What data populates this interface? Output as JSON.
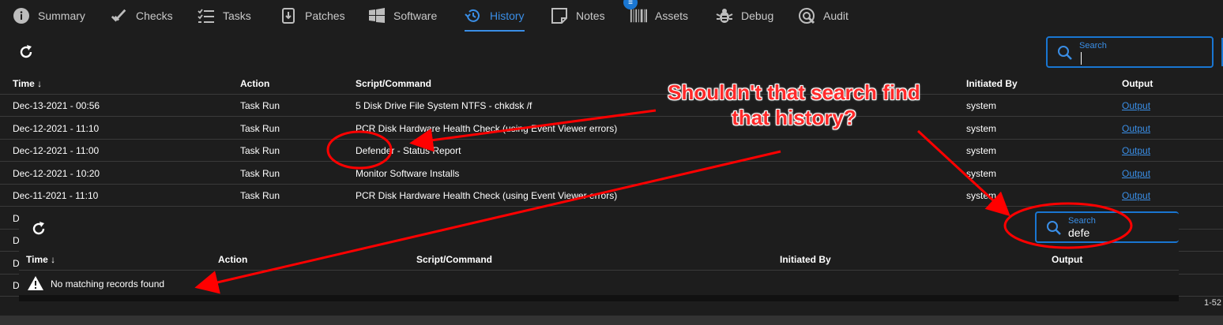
{
  "tabs": [
    {
      "label": "Summary",
      "icon": "info-icon"
    },
    {
      "label": "Checks",
      "icon": "double-check-icon"
    },
    {
      "label": "Tasks",
      "icon": "checklist-icon"
    },
    {
      "label": "Patches",
      "icon": "download-box-icon"
    },
    {
      "label": "Software",
      "icon": "windows-icon"
    },
    {
      "label": "History",
      "icon": "history-icon",
      "active": true
    },
    {
      "label": "Notes",
      "icon": "note-icon"
    },
    {
      "label": "Assets",
      "icon": "barcode-icon"
    },
    {
      "label": "Debug",
      "icon": "bug-icon"
    },
    {
      "label": "Audit",
      "icon": "audit-search-icon"
    }
  ],
  "notes_badge": "≡",
  "search_main": {
    "label": "Search",
    "value": ""
  },
  "search_popup": {
    "label": "Search",
    "value": "defe"
  },
  "columns": [
    "Time ↓",
    "Action",
    "Script/Command",
    "Initiated By",
    "Output"
  ],
  "rows": [
    {
      "time": "Dec-13-2021 - 00:56",
      "action": "Task Run",
      "script": "5 Disk Drive File System NTFS - chkdsk /f",
      "by": "system",
      "output": "Output"
    },
    {
      "time": "Dec-12-2021 - 11:10",
      "action": "Task Run",
      "script": "PCR Disk Hardware Health Check (using Event Viewer errors)",
      "by": "system",
      "output": "Output"
    },
    {
      "time": "Dec-12-2021 - 11:00",
      "action": "Task Run",
      "script": "Defender - Status Report",
      "by": "system",
      "output": "Output"
    },
    {
      "time": "Dec-12-2021 - 10:20",
      "action": "Task Run",
      "script": "Monitor Software Installs",
      "by": "system",
      "output": "Output"
    },
    {
      "time": "Dec-11-2021 - 11:10",
      "action": "Task Run",
      "script": "PCR Disk Hardware Health Check (using Event Viewer errors)",
      "by": "system",
      "output": "Output"
    }
  ],
  "partial_rows": [
    "D",
    "D",
    "D",
    "D"
  ],
  "popup_columns": [
    "Time ↓",
    "Action",
    "Script/Command",
    "Initiated By",
    "Output"
  ],
  "no_records": "No matching records found",
  "page_count": "1-52",
  "annotation": "Shouldn't that search find that history?",
  "colors": {
    "accent": "#1976d2",
    "annotation": "#ff2a2a"
  }
}
